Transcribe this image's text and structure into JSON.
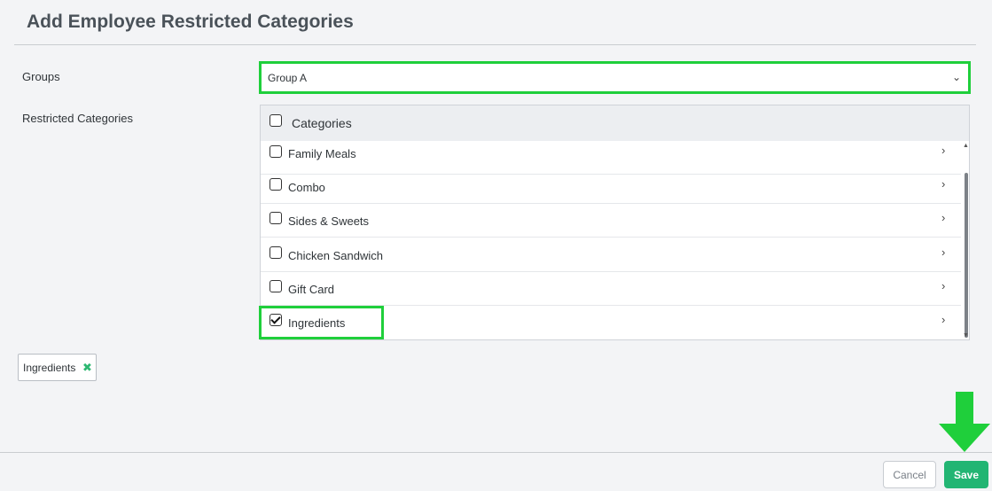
{
  "page": {
    "title": "Add Employee Restricted Categories"
  },
  "form": {
    "groups_label": "Groups",
    "groups_value": "Group A",
    "restricted_label": "Restricted Categories"
  },
  "categories": {
    "header_label": "Categories",
    "header_checked": false,
    "items": [
      {
        "label": "Family Meals",
        "checked": false
      },
      {
        "label": "Combo",
        "checked": false
      },
      {
        "label": "Sides & Sweets",
        "checked": false
      },
      {
        "label": "Chicken Sandwich",
        "checked": false
      },
      {
        "label": "Gift Card",
        "checked": false
      },
      {
        "label": "Ingredients",
        "checked": true
      }
    ]
  },
  "selected_chips": [
    {
      "label": "Ingredients",
      "remove_icon": "✖"
    }
  ],
  "icons": {
    "select_caret": "⌄",
    "row_chevron": "›",
    "scroll_up": "▲",
    "scroll_down": "▼"
  },
  "footer": {
    "cancel_label": "Cancel",
    "save_label": "Save"
  },
  "colors": {
    "highlight": "#1fcf3b",
    "save_button": "#22b573",
    "chip_remove": "#2eb872",
    "arrow": "#1fcf3b"
  }
}
